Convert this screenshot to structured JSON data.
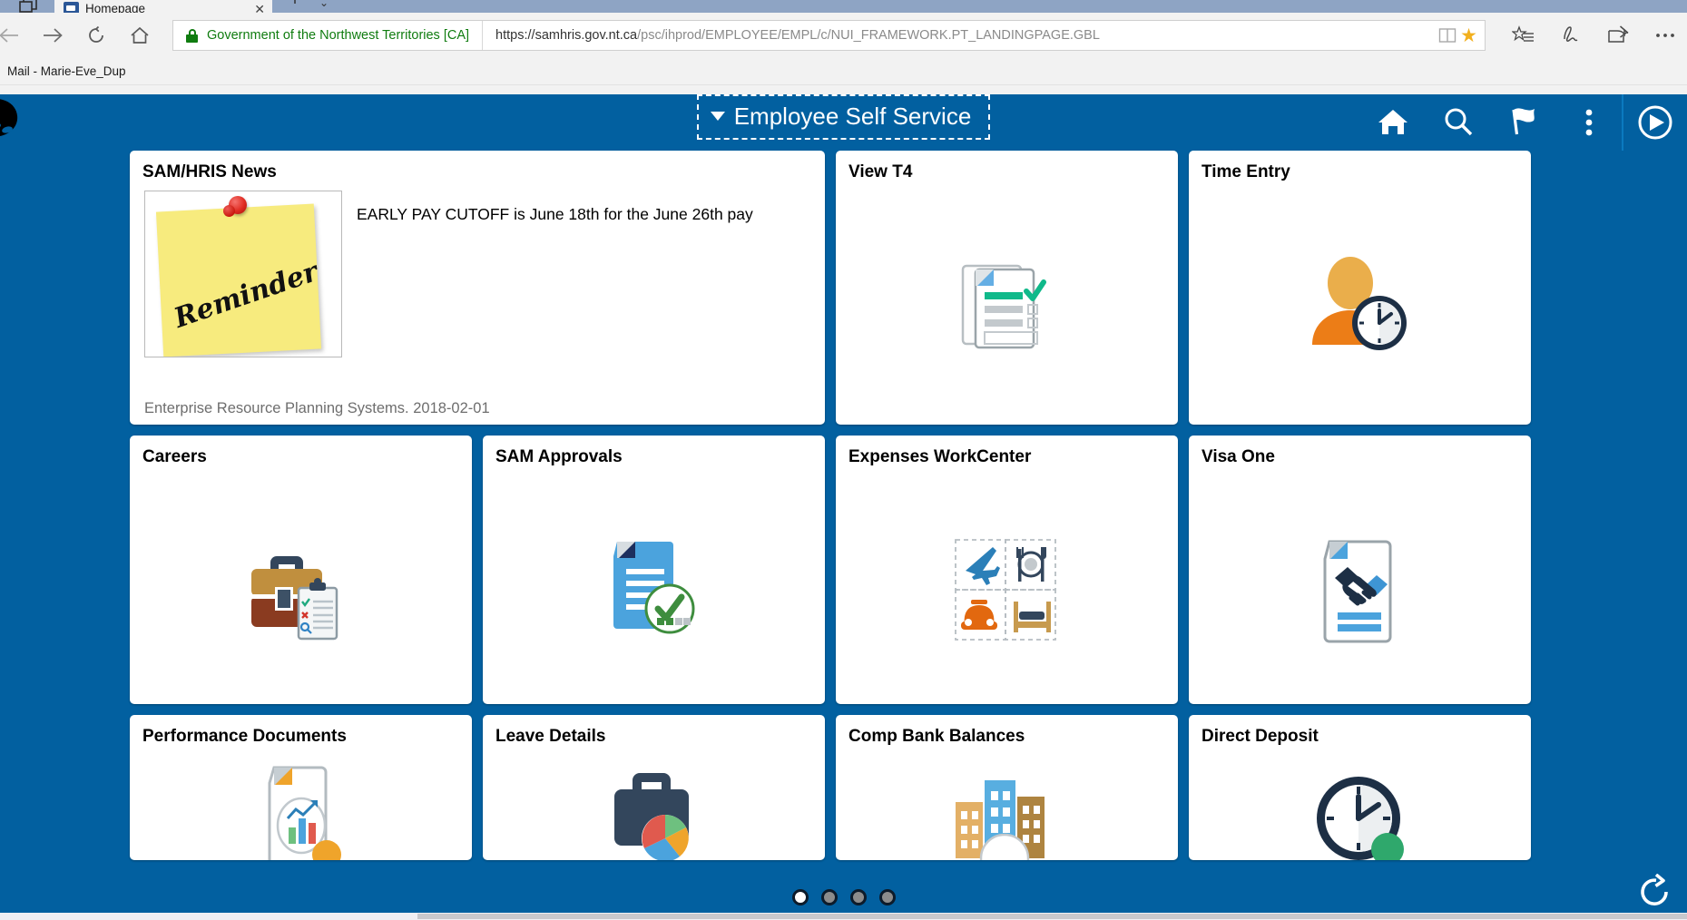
{
  "browser": {
    "tab": {
      "title": "Homepage",
      "close_label": "✕",
      "favicon_name": "peoplesoft-favicon"
    },
    "new_tab_label": "+",
    "tab_list_label": "⌄",
    "nav": {
      "back_label": "←",
      "forward_label": "→",
      "refresh_label": "↻",
      "home_label": "⌂"
    },
    "address": {
      "org_name": "Government of the Northwest Territories [CA]",
      "url_host": "https://samhris.gov.nt.ca",
      "url_path": "/psc/ihprod/EMPLOYEE/EMPL/c/NUI_FRAMEWORK.PT_LANDINGPAGE.GBL",
      "url_full": "https://samhris.gov.nt.ca/psc/ihprod/EMPLOYEE/EMPL/c/NUI_FRAMEWORK.PT_LANDINGPAGE.GBL",
      "reading_view_label": "Reading view",
      "favorite_label": "★"
    },
    "toolbar_icons": [
      "favorites-icon",
      "notes-icon",
      "share-icon",
      "more-icon"
    ],
    "favorites_bar": [
      {
        "label": "Mail - Marie-Eve_Dup"
      }
    ]
  },
  "app": {
    "header": {
      "title": "Employee Self Service",
      "dropdown_caret": "▼",
      "logo_name": "polar-bear-logo",
      "actions": [
        {
          "name": "home-icon",
          "label": "Home"
        },
        {
          "name": "search-icon",
          "label": "Search"
        },
        {
          "name": "flag-icon",
          "label": "Notifications"
        },
        {
          "name": "more-options-icon",
          "label": "Actions"
        },
        {
          "name": "navbar-icon",
          "label": "NavBar"
        }
      ]
    },
    "brand_color": "#0260a0",
    "tiles": [
      {
        "id": "sam-hris-news",
        "title": "SAM/HRIS News",
        "type": "news",
        "image_name": "reminder-sticky-note",
        "image_text": "Reminder",
        "headline": "EARLY PAY CUTOFF is June 18th for the June 26th pay",
        "footer": "Enterprise Resource Planning Systems. 2018-02-01"
      },
      {
        "id": "view-t4",
        "title": "View T4",
        "icon_name": "documents-checklist-icon"
      },
      {
        "id": "time-entry",
        "title": "Time Entry",
        "icon_name": "person-clock-icon"
      },
      {
        "id": "careers",
        "title": "Careers",
        "icon_name": "briefcase-clipboard-icon"
      },
      {
        "id": "sam-approvals",
        "title": "SAM Approvals",
        "icon_name": "document-approved-icon"
      },
      {
        "id": "expenses-workcenter",
        "title": "Expenses WorkCenter",
        "icon_name": "travel-expenses-grid-icon"
      },
      {
        "id": "visa-one",
        "title": "Visa One",
        "icon_name": "handshake-document-icon"
      },
      {
        "id": "performance-documents",
        "title": "Performance Documents",
        "icon_name": "document-chart-icon"
      },
      {
        "id": "leave-details",
        "title": "Leave Details",
        "icon_name": "suitcase-piechart-icon"
      },
      {
        "id": "comp-bank-balances",
        "title": "Comp Bank Balances",
        "icon_name": "buildings-icon"
      },
      {
        "id": "direct-deposit",
        "title": "Direct Deposit",
        "icon_name": "clock-icon"
      }
    ],
    "pagination": {
      "pages": 4,
      "active_page": 1,
      "page_labels": [
        "1",
        "2",
        "3",
        "4"
      ]
    },
    "refresh_label": "Refresh"
  }
}
